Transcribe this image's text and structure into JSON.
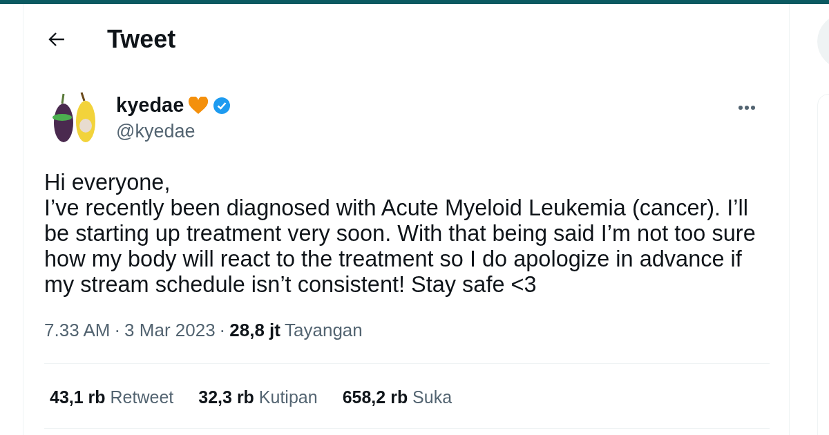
{
  "header": {
    "title": "Tweet"
  },
  "author": {
    "name": "kyedae",
    "handle": "@kyedae",
    "verified": true
  },
  "tweet": {
    "text": "Hi everyone,\nI’ve recently been diagnosed with Acute Myeloid Leukemia (cancer). I’ll be starting up treatment very soon. With that being said I’m not too sure how my body will react to the treatment so I do apologize in advance if my stream schedule isn’t consistent! Stay safe <3"
  },
  "meta": {
    "time": "7.33 AM",
    "separator_1": "·",
    "date": "3 Mar 2023",
    "separator_2": "·",
    "views_count": "28,8 jt",
    "views_label": "Tayangan"
  },
  "stats": [
    {
      "count": "43,1 rb",
      "label": "Retweet"
    },
    {
      "count": "32,3 rb",
      "label": "Kutipan"
    },
    {
      "count": "658,2 rb",
      "label": "Suka"
    }
  ]
}
